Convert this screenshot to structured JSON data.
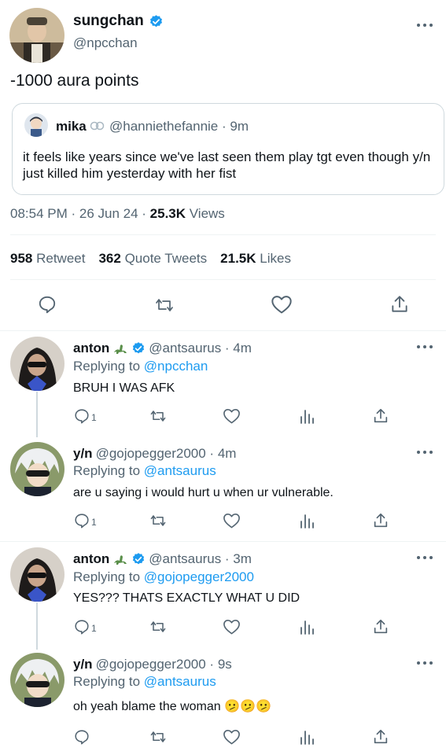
{
  "main_tweet": {
    "display_name": "sungchan",
    "handle": "@npcchan",
    "verified": true,
    "text": "-1000 aura points",
    "quote": {
      "display_name": "mika",
      "handle_time": "@hanniethefannie · 9m",
      "text": "it feels like years since we've last seen them play tgt even though y/n just killed him yesterday with her fist"
    },
    "meta": {
      "time_date": "08:54 PM · 26 Jun 24 · ",
      "views_count": "25.3K",
      "views_label": " Views"
    },
    "stats": [
      {
        "count": "958",
        "label": " Retweet"
      },
      {
        "count": "362",
        "label": " Quote Tweets"
      },
      {
        "count": "21.5K",
        "label": " Likes"
      }
    ]
  },
  "replies": [
    {
      "display_name": "anton",
      "emoji_name": "dinosaur-icon",
      "verified": true,
      "handle_time": "@antsaurus · 4m",
      "replying_prefix": "Replying to ",
      "replying_to": "@npcchan",
      "text": "BRUH I WAS AFK",
      "reply_count": "1"
    },
    {
      "display_name": "y/n",
      "verified": false,
      "handle_time": "@gojopegger2000 · 4m",
      "replying_prefix": "Replying to ",
      "replying_to": "@antsaurus",
      "text": "are u saying i would hurt u when ur vulnerable.",
      "reply_count": "1"
    },
    {
      "display_name": "anton",
      "emoji_name": "dinosaur-icon",
      "verified": true,
      "handle_time": "@antsaurus · 3m",
      "replying_prefix": "Replying to ",
      "replying_to": "@gojopegger2000",
      "text": "YES??? THATS EXACTLY WHAT U DID",
      "reply_count": "1"
    },
    {
      "display_name": "y/n",
      "verified": false,
      "handle_time": "@gojopegger2000 · 9s",
      "replying_prefix": "Replying to ",
      "replying_to": "@antsaurus",
      "text": "oh yeah blame the woman 🫤🫤🫤",
      "reply_count": ""
    }
  ],
  "colors": {
    "accent": "#1d9bf0",
    "secondary_text": "#536471",
    "primary_text": "#0f1419",
    "divider": "#eff3f4"
  }
}
